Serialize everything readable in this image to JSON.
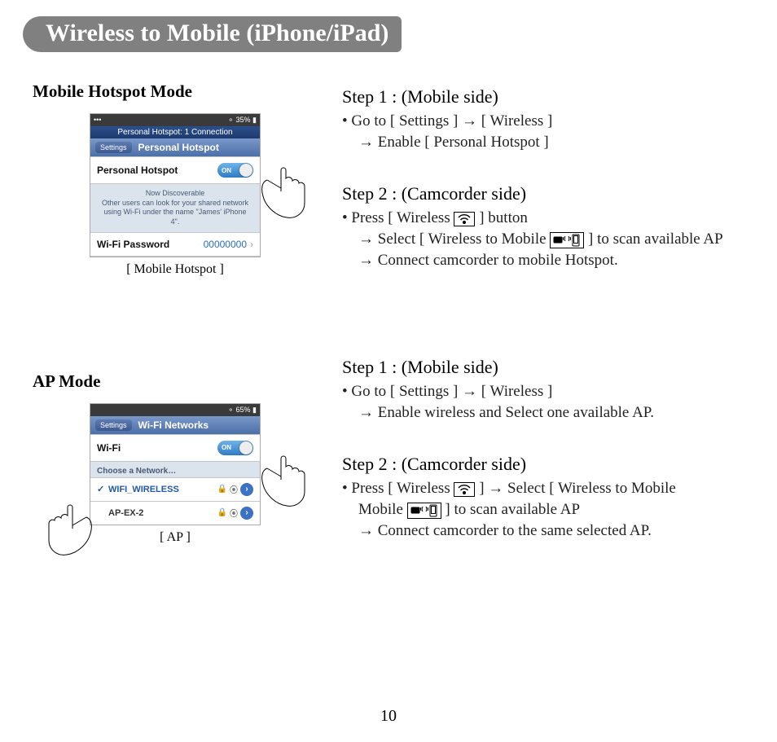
{
  "title": "Wireless to Mobile (iPhone/iPad)",
  "page_number": "10",
  "left": {
    "hotspot": {
      "heading": "Mobile Hotspot Mode",
      "caption": "[ Mobile Hotspot ]",
      "statusbar_left": "•••",
      "statusbar_right": "35%",
      "banner": "Personal Hotspot: 1 Connection",
      "nav_back": "Settings",
      "nav_title": "Personal Hotspot",
      "row1_label": "Personal Hotspot",
      "toggle_text": "ON",
      "discover_title": "Now Discoverable",
      "discover_body": "Other users can look for your shared network using Wi-Fi under the name \"James' iPhone 4\".",
      "row2_label": "Wi-Fi Password",
      "row2_value": "00000000"
    },
    "ap": {
      "heading": "AP Mode",
      "caption": "[ AP ]",
      "statusbar_left": "",
      "statusbar_right": "65%",
      "nav_back": "Settings",
      "nav_title": "Wi-Fi Networks",
      "row1_label": "Wi-Fi",
      "toggle_text": "ON",
      "choose_label": "Choose a Network…",
      "net1": "WIFI_WIRELESS",
      "net2": "AP-EX-2"
    }
  },
  "right": {
    "hotspot_step1": {
      "title": "Step 1 : (Mobile side)",
      "line1": "• Go to [ Settings ] → [ Wireless ]",
      "line2": "→ Enable [ Personal Hotspot ]"
    },
    "hotspot_step2": {
      "title": "Step 2 : (Camcorder side)",
      "line1a": "• Press [ Wireless ",
      "line1b": " ] button",
      "line2a": "→ Select [ Wireless to Mobile ",
      "line2b": " ] to scan available AP",
      "line3": "→ Connect camcorder to mobile Hotspot."
    },
    "ap_step1": {
      "title": "Step 1 : (Mobile side)",
      "line1": "• Go to [ Settings ] → [ Wireless ]",
      "line2": "→ Enable wireless and Select one available AP."
    },
    "ap_step2": {
      "title": "Step 2 : (Camcorder side)",
      "line1a": "• Press [ Wireless ",
      "line1b": " ] → Select [ Wireless to Mobile ",
      "line1c": " ] to scan available AP",
      "line2": "→ Connect camcorder to the same selected AP."
    }
  }
}
